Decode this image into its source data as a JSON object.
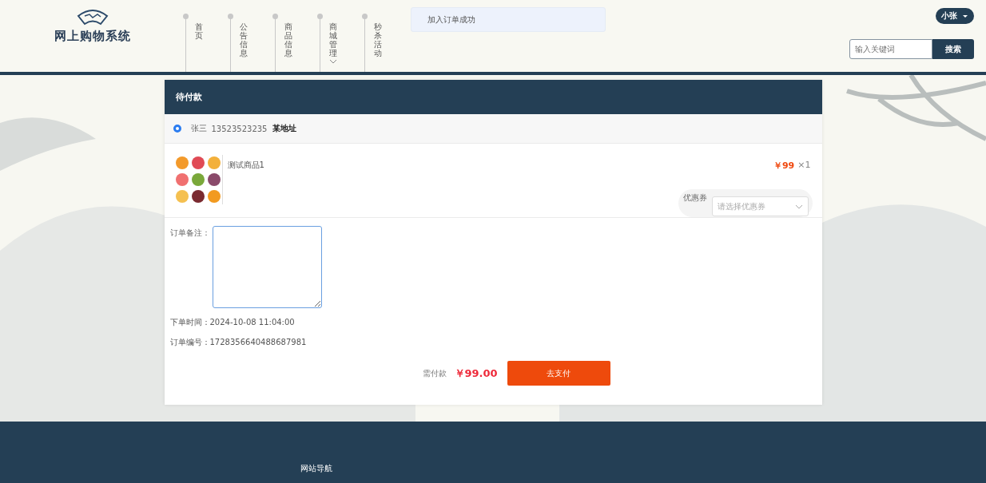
{
  "header": {
    "logo_text": "网上购物系统",
    "nav": [
      {
        "label": "首页",
        "dropdown": false
      },
      {
        "label": "公告信息",
        "dropdown": false
      },
      {
        "label": "商品信息",
        "dropdown": false
      },
      {
        "label": "商城管理",
        "dropdown": true
      },
      {
        "label": "秒杀活动",
        "dropdown": false
      }
    ],
    "toast": "加入订单成功",
    "user_menu": "小张",
    "search": {
      "placeholder": "输入关键词",
      "button": "搜索"
    }
  },
  "order": {
    "title": "待付款",
    "address": {
      "selected": true,
      "name": "张三",
      "phone": "13523523235",
      "address": "某地址"
    },
    "items": [
      {
        "name": "测试商品1",
        "price": "￥99",
        "quantity": "×1"
      }
    ],
    "coupon": {
      "label": "优惠券",
      "placeholder": "请选择优惠券"
    },
    "remark": {
      "label": "订单备注：",
      "focused": true
    },
    "order_time": "下单时间：2024-10-08 11:04:00",
    "order_no": "订单编号：1728356640488687981",
    "total_label": "需付款",
    "total": "￥99.00",
    "pay_button": "去支付"
  },
  "footer": {
    "links": [
      "网站导航"
    ]
  }
}
